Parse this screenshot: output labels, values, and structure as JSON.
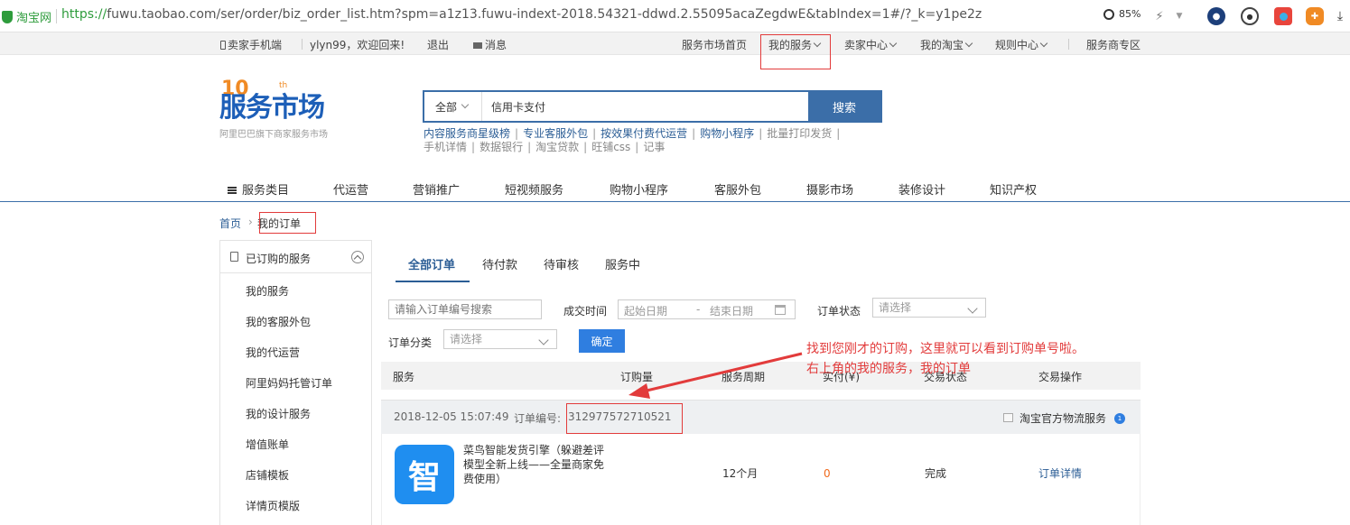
{
  "browser": {
    "site_name": "淘宝网",
    "url_protocol": "https://",
    "url_rest": "fuwu.taobao.com/ser/order/biz_order_list.htm?spm=a1z13.fuwu-indext-2018.54321-ddwd.2.55095acaZegdwE&tabIndex=1#/?_k=y1pe2z",
    "zoom": "85%"
  },
  "topbar": {
    "mobile": "卖家手机端",
    "welcome": "ylyn99，欢迎回来!",
    "logout": "退出",
    "messages": "消息",
    "market_home": "服务市场首页",
    "my_services": "我的服务",
    "seller_center": "卖家中心",
    "my_taobao": "我的淘宝",
    "rules_center": "规则中心",
    "provider_zone": "服务商专区"
  },
  "logo": {
    "text": "服务市场",
    "anniversary": "10",
    "suffix": "th",
    "subtitle": "阿里巴巴旗下商家服务市场"
  },
  "search": {
    "category": "全部",
    "value": "信用卡支付",
    "button": "搜索"
  },
  "hotwords": {
    "row1": [
      "内容服务商星级榜",
      "专业客服外包",
      "按效果付费代运营",
      "购物小程序",
      "批量打印发货"
    ],
    "row2": [
      "手机详情",
      "数据银行",
      "淘宝贷款",
      "旺铺css",
      "记事"
    ]
  },
  "catnav": [
    "服务类目",
    "代运营",
    "营销推广",
    "短视频服务",
    "购物小程序",
    "客服外包",
    "摄影市场",
    "装修设计",
    "知识产权"
  ],
  "breadcrumb": {
    "home": "首页",
    "arrow": "›",
    "current": "我的订单"
  },
  "sidebar": {
    "header": "已订购的服务",
    "items": [
      "我的服务",
      "我的客服外包",
      "我的代运营",
      "阿里妈妈托管订单",
      "我的设计服务",
      "增值账单",
      "店铺模板",
      "详情页模版"
    ]
  },
  "tabs": [
    "全部订单",
    "待付款",
    "待审核",
    "服务中"
  ],
  "filters": {
    "order_search_placeholder": "请输入订单编号搜索",
    "deal_time_label": "成交时间",
    "start_date": "起始日期",
    "date_sep": "-",
    "end_date": "结束日期",
    "order_status_label": "订单状态",
    "select_placeholder": "请选择",
    "order_category_label": "订单分类",
    "confirm": "确定"
  },
  "annotation": {
    "line1": "找到您刚才的订购，这里就可以看到订购单号啦。",
    "line2": "右上角的我的服务，我的订单"
  },
  "table": {
    "headers": [
      "服务",
      "订购量",
      "服务周期",
      "实付(¥)",
      "交易状态",
      "交易操作"
    ],
    "order": {
      "date": "2018-12-05 15:07:49",
      "order_no_label": "订单编号:",
      "order_no": "312977572710521",
      "service_tag": "淘宝官方物流服务",
      "badge": "1",
      "product_icon_glyph": "智",
      "product_title": "菜鸟智能发货引擎（躲避差评模型全新上线——全量商家免费使用）",
      "period": "12个月",
      "paid": "0",
      "status": "完成",
      "action": "订单详情"
    }
  },
  "colors": {
    "brand_blue": "#3b6ea8",
    "link_blue": "#2b5d95",
    "annotation_red": "#e23b3b",
    "confirm_blue": "#2f7ee0",
    "price_orange": "#f06a1d"
  }
}
